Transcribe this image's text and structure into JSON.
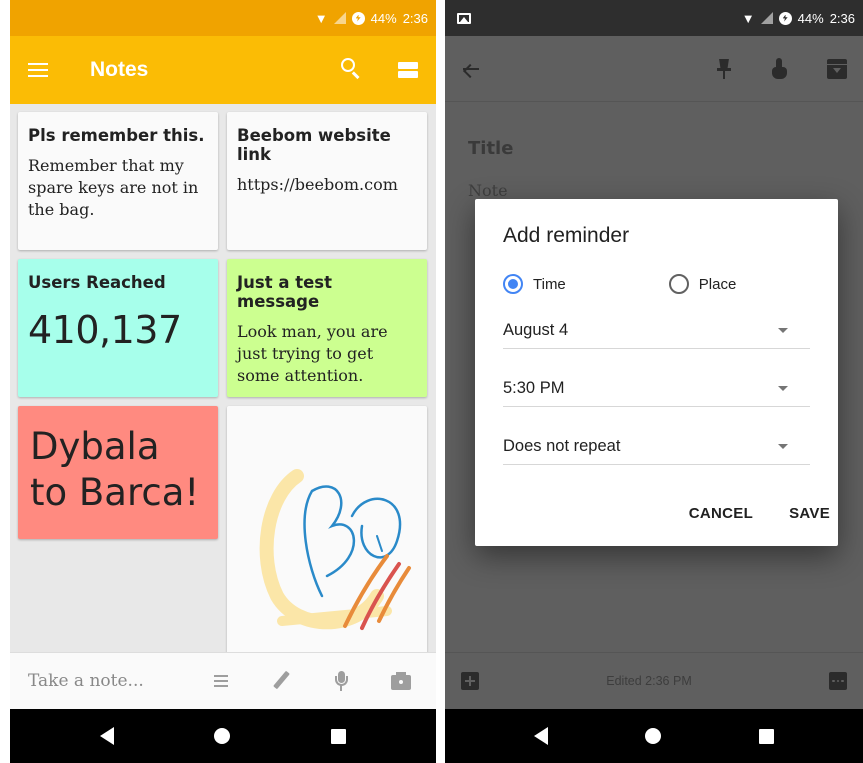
{
  "status_bar": {
    "battery": "44%",
    "time": "2:36"
  },
  "notes_app": {
    "title": "Notes",
    "notes": [
      {
        "title": "Pls remember this.",
        "body": "Remember that my spare keys are not in the bag.",
        "color": "#fafafa"
      },
      {
        "title": "Beebom website link",
        "body": "https://beebom.com",
        "color": "#fafafa"
      },
      {
        "title": "Users Reached",
        "body": "410,137",
        "color": "#a7ffeb"
      },
      {
        "title": "Just a test message",
        "body": "Look man, you are just trying to get some attention.",
        "color": "#ccff90"
      },
      {
        "title": "",
        "body": "Dybala to Barca!",
        "color": "#ff8a80"
      }
    ],
    "take_note_placeholder": "Take a note...",
    "accent": "#fbbc05"
  },
  "editor": {
    "title_placeholder": "Title",
    "note_placeholder": "Note",
    "edited": "Edited 2:36 PM"
  },
  "reminder_dialog": {
    "title": "Add reminder",
    "option_time": "Time",
    "option_place": "Place",
    "selected_option": "Time",
    "date": "August 4",
    "time": "5:30 PM",
    "repeat": "Does not repeat",
    "cancel": "CANCEL",
    "save": "SAVE",
    "accent": "#4285f4"
  }
}
